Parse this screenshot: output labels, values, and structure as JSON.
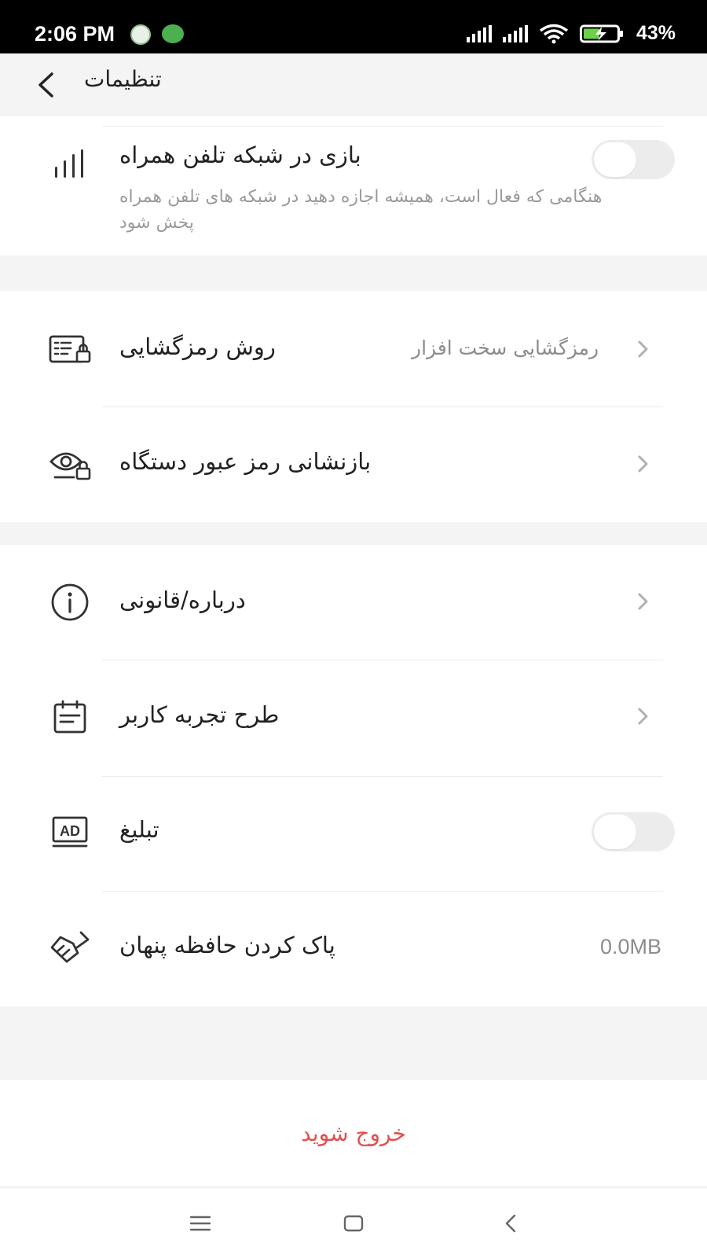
{
  "status_bar": {
    "time": "2:06 PM",
    "battery_percent": "43%",
    "icons": [
      "notification-app-icon",
      "android-app-icon",
      "signal-1-icon",
      "signal-2-icon",
      "wifi-icon",
      "battery-charging-icon"
    ]
  },
  "header": {
    "title": "تنظیمات",
    "back_icon": "chevron-left-icon"
  },
  "sections": {
    "mobile_data": {
      "label": "بازی در شبکه تلفن همراه",
      "description": "هنگامی که فعال است، همیشه اجازه دهید در شبکه های تلفن همراه پخش شود",
      "icon": "signal-bars-icon",
      "toggle_on": false
    },
    "decoding": {
      "label": "روش رمزگشایی",
      "value": "رمزگشایی سخت افزار",
      "icon": "decoder-lock-icon"
    },
    "reset_password": {
      "label": "بازنشانی رمز عبور دستگاه",
      "icon": "eye-lock-icon"
    },
    "about": {
      "label": "درباره/قانونی",
      "icon": "info-icon"
    },
    "ux_plan": {
      "label": "طرح تجربه کاربر",
      "icon": "calendar-note-icon"
    },
    "ads": {
      "label": "تبلیغ",
      "icon": "ad-icon",
      "toggle_on": false
    },
    "cache": {
      "label": "پاک کردن حافظه پنهان",
      "value": "0.0MB",
      "icon": "broom-icon"
    }
  },
  "logout": {
    "label": "خروج شوید",
    "color": "#e05050"
  },
  "nav_bar": {
    "icons": [
      "menu-icon",
      "home-icon",
      "back-icon"
    ]
  }
}
